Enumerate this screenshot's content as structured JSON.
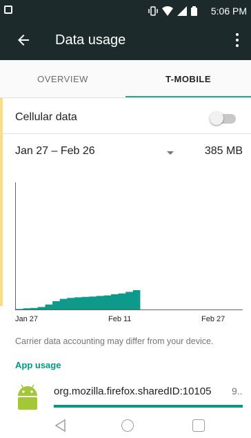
{
  "status_bar": {
    "time": "5:06 PM",
    "icons": [
      "vibrate-icon",
      "wifi-icon",
      "signal-icon",
      "battery-icon"
    ]
  },
  "app_bar": {
    "title": "Data usage",
    "back_icon": "arrow-back-icon",
    "menu_icon": "more-vert-icon"
  },
  "tabs": [
    {
      "label": "OVERVIEW",
      "selected": false
    },
    {
      "label": "T-MOBILE",
      "selected": true
    }
  ],
  "cellular": {
    "label": "Cellular data",
    "enabled": false
  },
  "cycle": {
    "range": "Jan 27 – Feb 26",
    "usage": "385 MB"
  },
  "chart_data": {
    "type": "area",
    "xlabel": "",
    "ylabel": "",
    "x_ticks": [
      "Jan 27",
      "Feb 11",
      "Feb 27"
    ],
    "days": [
      0,
      1,
      2,
      3,
      4,
      5,
      6,
      7,
      8,
      9,
      10,
      11,
      12,
      13,
      14,
      15,
      16
    ],
    "values": [
      0.03,
      0.06,
      0.08,
      0.13,
      0.26,
      0.43,
      0.55,
      0.6,
      0.63,
      0.65,
      0.67,
      0.7,
      0.73,
      0.79,
      0.83,
      0.91,
      1.0
    ],
    "color": "#0e9a8a",
    "y_unit": "fraction of current usage"
  },
  "disclaimer": "Carrier data accounting may differ from your device.",
  "app_usage": {
    "header": "App usage",
    "items": [
      {
        "name": "org.mozilla.firefox.sharedID:10105",
        "size": "9..",
        "fraction": 1.0,
        "icon": "android-icon"
      }
    ]
  },
  "colors": {
    "toolbar": "#1d2a2b",
    "accent": "#009688",
    "chart_fill": "#0e9a8a"
  },
  "nav_bar": [
    "nav-back-icon",
    "nav-home-icon",
    "nav-recents-icon"
  ]
}
